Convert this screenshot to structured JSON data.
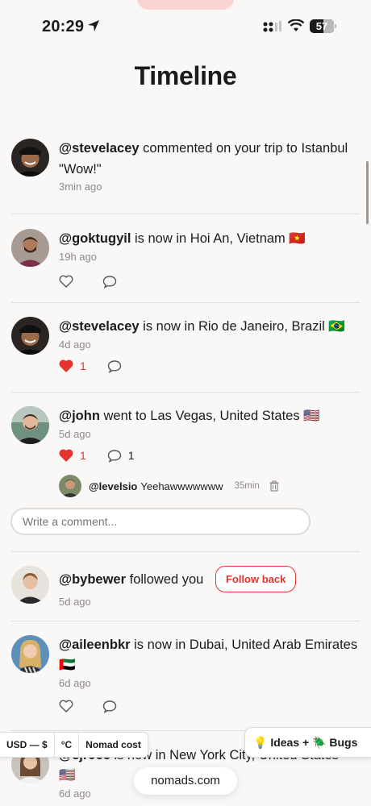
{
  "status_bar": {
    "time": "20:29",
    "battery": "57"
  },
  "page": {
    "title": "Timeline"
  },
  "feed": [
    {
      "handle": "@stevelacey",
      "text": " commented on your trip to Istanbul",
      "quote": "\"Wow!\"",
      "time": "3min ago"
    },
    {
      "handle": "@goktugyil",
      "text": " is now in Hoi An, Vietnam 🇻🇳",
      "time": "19h ago"
    },
    {
      "handle": "@stevelacey",
      "text": " is now in Rio de Janeiro, Brazil 🇧🇷",
      "time": "4d ago",
      "likes": "1"
    },
    {
      "handle": "@john",
      "text": " went to Las Vegas, United States 🇺🇸",
      "time": "5d ago",
      "likes": "1",
      "comments": "1",
      "reply": {
        "handle": "@levelsio",
        "text": "Yeehawwwwwww",
        "time": "35min"
      },
      "comment_placeholder": "Write a comment..."
    },
    {
      "handle": "@bybewer",
      "text": " followed you",
      "time": "5d ago",
      "follow_label": "Follow back"
    },
    {
      "handle": "@aileenbkr",
      "text": " is now in Dubai, United Arab Emirates 🇦🇪",
      "time": "6d ago"
    },
    {
      "handle": "@cjr066",
      "text": " is now in New York City, United States",
      "flag": "🇺🇸",
      "time": "6d ago"
    }
  ],
  "bottom_bar": {
    "currency": "USD — $",
    "unit": "°C",
    "cost": "Nomad cost",
    "ideas": "💡 Ideas + 🪲 Bugs",
    "site": "nomads.com"
  },
  "colors": {
    "accent": "#e5342e",
    "background": "#faf8f7",
    "status_pill": "#fbd3d3"
  },
  "icons": [
    "location-arrow-icon",
    "signal-icon",
    "wifi-icon",
    "battery-icon",
    "heart-outline-icon",
    "heart-filled-icon",
    "comment-icon",
    "trash-icon"
  ]
}
